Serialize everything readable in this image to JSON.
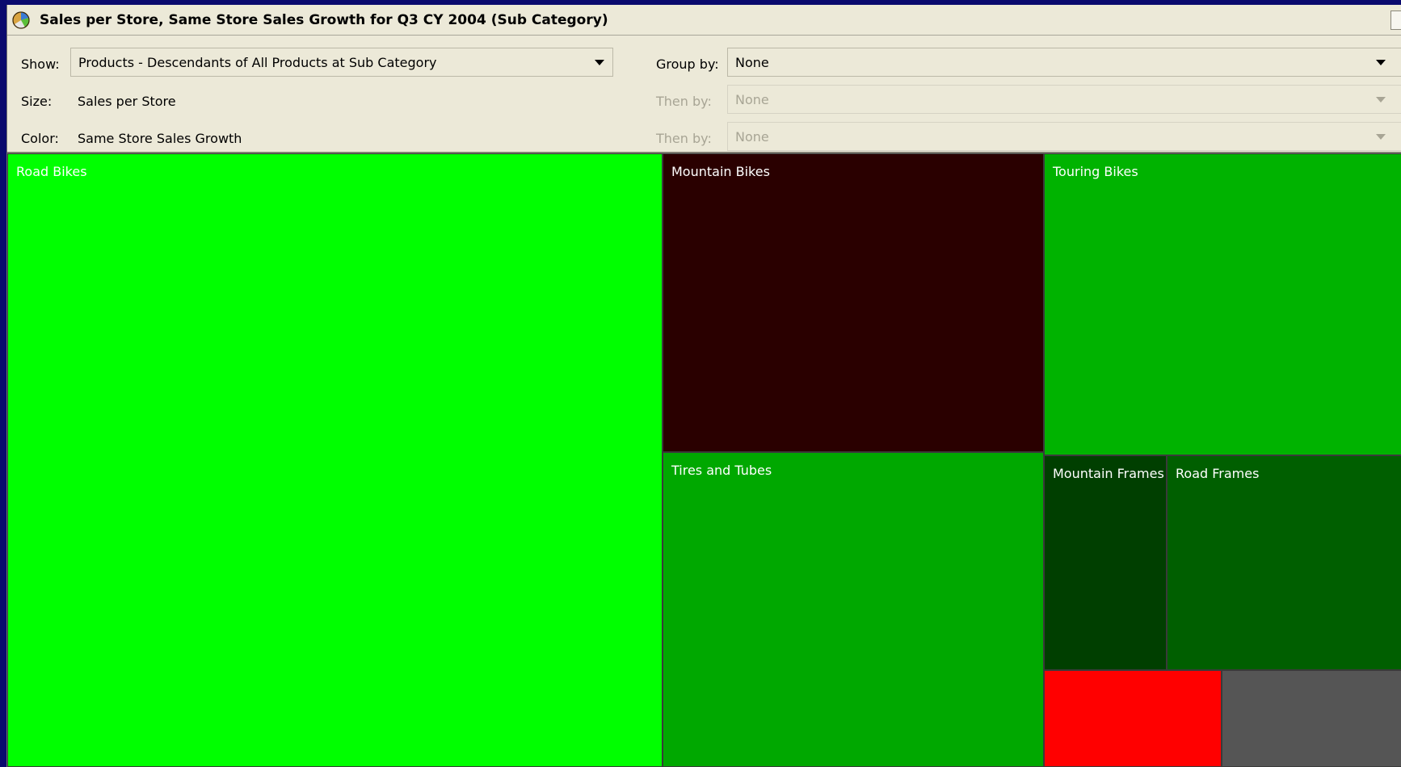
{
  "window": {
    "title": "Sales per Store, Same Store Sales Growth for Q3 CY  2004 (Sub Category)",
    "icon": "treemap-chart-icon"
  },
  "controls": {
    "show_label": "Show:",
    "show_value": "Products - Descendants of All Products at Sub Category",
    "size_label": "Size:",
    "size_value": "Sales per Store",
    "color_label": "Color:",
    "color_value": "Same Store Sales Growth",
    "group_by_label": "Group by:",
    "group_by_value": "None",
    "then_by_1_label": "Then by:",
    "then_by_1_value": "None",
    "then_by_2_label": "Then by:",
    "then_by_2_value": "None"
  },
  "treemap": {
    "tiles": [
      {
        "label": "Road Bikes",
        "color": "#00ff00"
      },
      {
        "label": "Mountain Bikes",
        "color": "#2a0000"
      },
      {
        "label": "Touring Bikes",
        "color": "#00b300"
      },
      {
        "label": "Tires and Tubes",
        "color": "#00a800"
      },
      {
        "label": "Mountain Frames",
        "color": "#003f00"
      },
      {
        "label": "Road Frames",
        "color": "#005f00"
      },
      {
        "label": "",
        "color": "#ff0000"
      },
      {
        "label": "",
        "color": "#555555"
      }
    ]
  }
}
